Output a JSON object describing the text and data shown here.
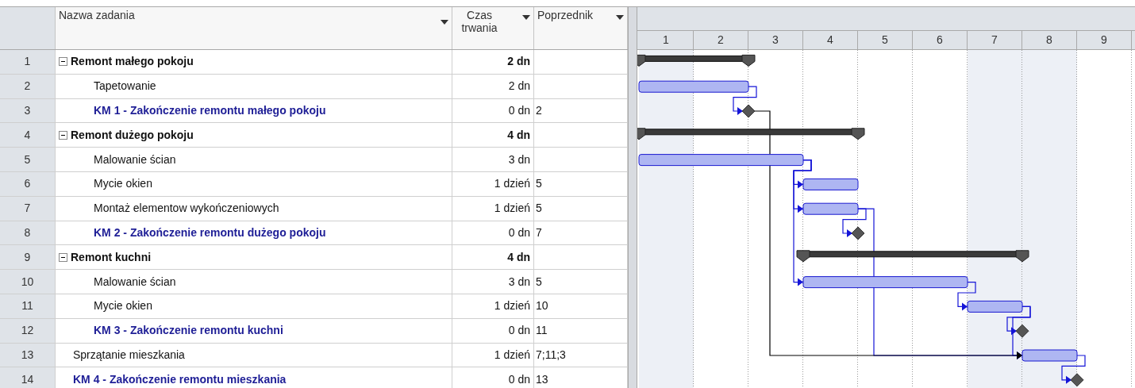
{
  "columns": [
    {
      "label": "Nazwa zadania"
    },
    {
      "label": "Czas trwania"
    },
    {
      "label": "Poprzednik"
    }
  ],
  "timescale": [
    {
      "label": "1",
      "nonworking": true
    },
    {
      "label": "2",
      "nonworking": false
    },
    {
      "label": "3",
      "nonworking": false
    },
    {
      "label": "4",
      "nonworking": false
    },
    {
      "label": "5",
      "nonworking": false
    },
    {
      "label": "6",
      "nonworking": false
    },
    {
      "label": "7",
      "nonworking": true
    },
    {
      "label": "8",
      "nonworking": true
    },
    {
      "label": "9",
      "nonworking": false
    }
  ],
  "tasks": [
    {
      "id": "1",
      "kind": "summary",
      "expanded": true,
      "name": "Remont małego pokoju",
      "duration": "2 dn",
      "children": [
        {
          "id": "2",
          "kind": "task",
          "name": "Tapetowanie",
          "duration": "2 dn"
        },
        {
          "id": "3",
          "kind": "milestone",
          "name": "KM 1 - Zakończenie remontu małego pokoju",
          "duration": "0 dn",
          "predecessors": "2"
        }
      ]
    },
    {
      "id": "4",
      "kind": "summary",
      "expanded": true,
      "name": "Remont dużego pokoju",
      "duration": "4 dn",
      "children": [
        {
          "id": "5",
          "kind": "task",
          "name": "Malowanie ścian",
          "duration": "3 dn"
        },
        {
          "id": "6",
          "kind": "task",
          "name": "Mycie okien",
          "duration": "1 dzień",
          "predecessors": "5"
        },
        {
          "id": "7",
          "kind": "task",
          "name": "Montaż elementow wykończeniowych",
          "duration": "1 dzień",
          "predecessors": "5"
        },
        {
          "id": "8",
          "kind": "milestone",
          "name": "KM 2 - Zakończenie remontu dużego pokoju",
          "duration": "0 dn",
          "predecessors": "7"
        }
      ]
    },
    {
      "id": "9",
      "kind": "summary",
      "expanded": true,
      "name": "Remont kuchni",
      "duration": "4 dn",
      "children": [
        {
          "id": "10",
          "kind": "task",
          "name": "Malowanie ścian",
          "duration": "3 dn",
          "predecessors": "5"
        },
        {
          "id": "11",
          "kind": "task",
          "name": "Mycie okien",
          "duration": "1 dzień",
          "predecessors": "10"
        },
        {
          "id": "12",
          "kind": "milestone",
          "name": "KM 3 - Zakończenie remontu kuchni",
          "duration": "0 dn",
          "predecessors": "11"
        }
      ]
    },
    {
      "id": "13",
      "kind": "task",
      "name": "Sprzątanie mieszkania",
      "duration": "1 dzień",
      "predecessors": "7;11;3"
    },
    {
      "id": "14",
      "kind": "milestone",
      "name": "KM 4 - Zakończenie remontu mieszkania",
      "duration": "0 dn",
      "predecessors": "13"
    }
  ]
}
